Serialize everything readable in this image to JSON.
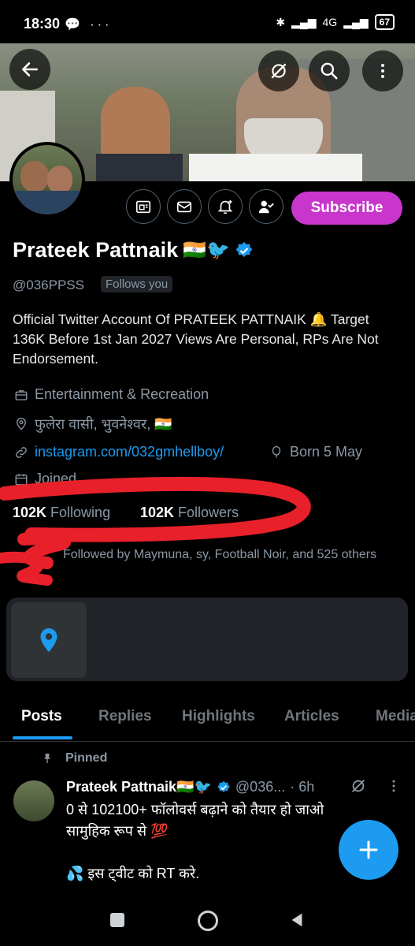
{
  "status": {
    "time": "18:30",
    "network": "4G",
    "battery": "67"
  },
  "profile": {
    "name": "Prateek Pattnaik",
    "name_emojis": "🇮🇳🐦",
    "handle": "@036PPSS",
    "follows_you": "Follows you",
    "bio": "Official Twitter Account Of PRATEEK PATTNAIK 🔔 Target 136K Before 1st Jan 2027 Views Are Personal, RPs Are Not Endorsement.",
    "category": "Entertainment & Recreation",
    "location": "फुलेरा वासी, भुवनेश्वर, 🇮🇳",
    "link": "instagram.com/032gmhellboy/",
    "born": "Born 5 May",
    "joined": "Joined ...",
    "following_count": "102K",
    "following_label": "Following",
    "followers_count": "102K",
    "followers_label": "Followers",
    "followed_by": "Followed by Maymuna, sy, Football Noir, and 525 others"
  },
  "actions": {
    "subscribe": "Subscribe"
  },
  "tabs": [
    "Posts",
    "Replies",
    "Highlights",
    "Articles",
    "Media"
  ],
  "tweet": {
    "pinned_label": "Pinned",
    "author": "Prateek Pattnaik🇮🇳🐦",
    "handle": "@036...",
    "time": "· 6h",
    "text_line1": "0 से 102100+ फॉलोवर्स बढ़ाने को तैयार हो जाओ",
    "text_line2": "सामुहिक रूप से 💯",
    "text_line3": "💦 इस ट्वीट को RT करे."
  },
  "colors": {
    "accent": "#1d9bf0",
    "subscribe": "#c936cc",
    "annotation": "#e8202a"
  }
}
